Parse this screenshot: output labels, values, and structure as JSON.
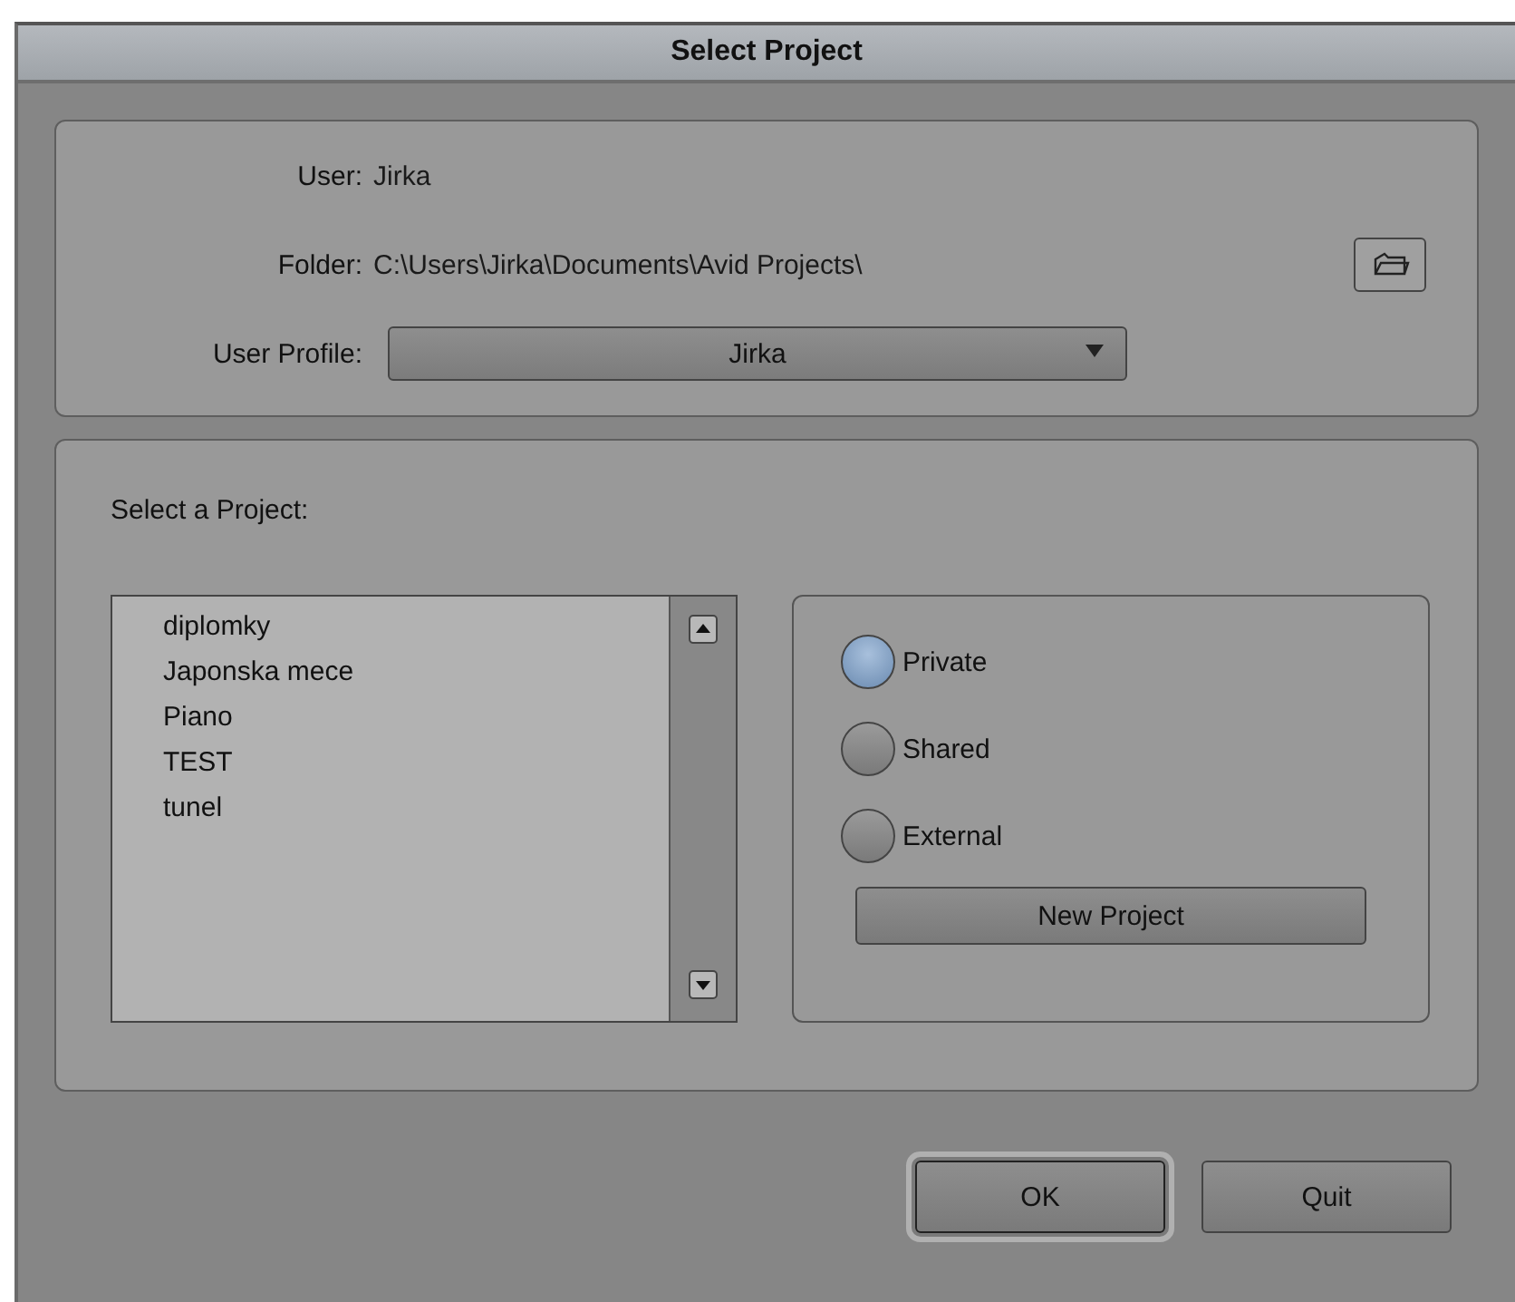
{
  "window": {
    "title": "Select Project"
  },
  "user": {
    "label": "User:",
    "value": "Jirka"
  },
  "folder": {
    "label": "Folder:",
    "value": "C:\\Users\\Jirka\\Documents\\Avid Projects\\"
  },
  "user_profile": {
    "label": "User Profile:",
    "value": "Jirka"
  },
  "project_list": {
    "label": "Select a Project:",
    "items": [
      "diplomky",
      "Japonska mece",
      "Piano",
      "TEST",
      "tunel"
    ]
  },
  "project_types": [
    {
      "label": "Private",
      "selected": true
    },
    {
      "label": "Shared",
      "selected": false
    },
    {
      "label": "External",
      "selected": false
    }
  ],
  "new_project_button": "New Project",
  "buttons": [
    {
      "label": "OK",
      "default": true
    },
    {
      "label": "Quit",
      "default": false
    }
  ]
}
